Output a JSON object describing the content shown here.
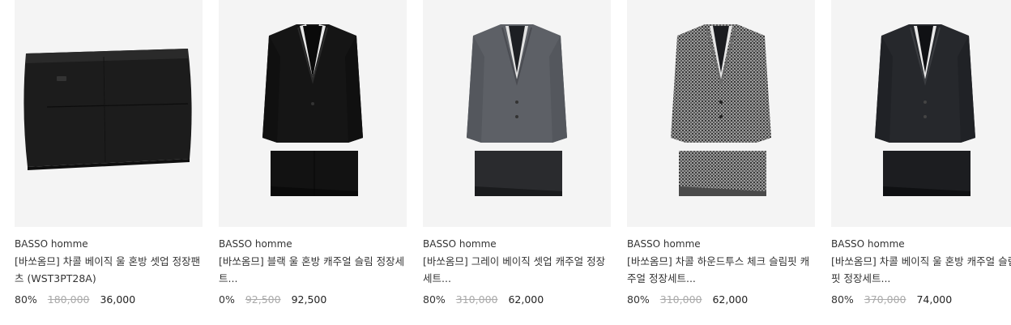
{
  "products": [
    {
      "brand": "BASSO homme",
      "title": "[바쏘옴므] 차콜 베이직 울 혼방 셋업 정장팬츠 (WST3PT28A)",
      "discount": "80%",
      "original_price": "180,000",
      "sale_price": "36,000",
      "image": "charcoal-pants-icon"
    },
    {
      "brand": "BASSO homme",
      "title": "[바쏘옴므] 블랙 울 혼방 캐주얼 슬림 정장세트...",
      "discount": "0%",
      "original_price": "92,500",
      "sale_price": "92,500",
      "image": "black-suit-icon"
    },
    {
      "brand": "BASSO homme",
      "title": "[바쏘옴므] 그레이 베이직 셋업 캐주얼 정장세트...",
      "discount": "80%",
      "original_price": "310,000",
      "sale_price": "62,000",
      "image": "gray-suit-icon"
    },
    {
      "brand": "BASSO homme",
      "title": "[바쏘옴므] 차콜 하운드투스 체크 슬림핏 캐주얼 정장세트...",
      "discount": "80%",
      "original_price": "310,000",
      "sale_price": "62,000",
      "image": "houndstooth-suit-icon"
    },
    {
      "brand": "BASSO homme",
      "title": "[바쏘옴므] 차콜 베이직 울 혼방 캐주얼 슬림핏 정장세트...",
      "discount": "80%",
      "original_price": "370,000",
      "sale_price": "74,000",
      "image": "charcoal-suit-icon"
    }
  ],
  "colors": {
    "thumb_bg": "#f4f4f4",
    "black": "#151515",
    "gray": "#5d6066",
    "houndstooth": "#8a8a8a",
    "charcoal": "#26282c"
  }
}
